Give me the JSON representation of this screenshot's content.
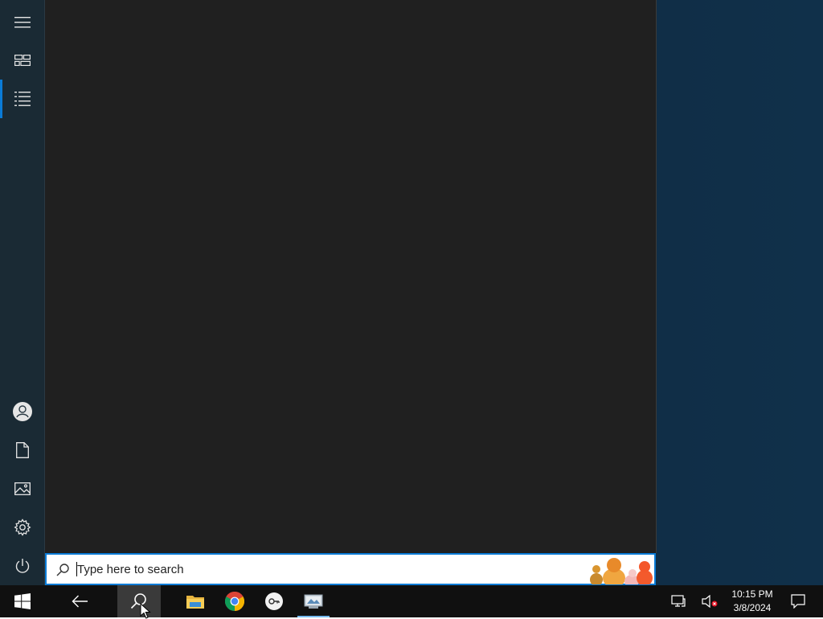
{
  "start_rail": {
    "top_items": [
      {
        "name": "expand-menu-button",
        "icon": "hamburger-icon"
      },
      {
        "name": "tiles-button",
        "icon": "tiles-icon"
      },
      {
        "name": "all-apps-button",
        "icon": "list-icon",
        "active": true
      }
    ],
    "bottom_items": [
      {
        "name": "user-account-button",
        "icon": "user-icon"
      },
      {
        "name": "documents-button",
        "icon": "document-icon"
      },
      {
        "name": "pictures-button",
        "icon": "picture-icon"
      },
      {
        "name": "settings-button",
        "icon": "gear-icon"
      },
      {
        "name": "power-button",
        "icon": "power-icon"
      }
    ]
  },
  "search": {
    "placeholder": "Type here to search",
    "value": ""
  },
  "taskbar": {
    "buttons": [
      {
        "name": "start-button",
        "icon": "windows-logo-icon"
      },
      {
        "name": "back-button",
        "icon": "back-arrow-icon"
      },
      {
        "name": "search-button",
        "icon": "search-icon",
        "pressed": true
      },
      {
        "name": "file-explorer-button",
        "icon": "folder-icon"
      },
      {
        "name": "chrome-button",
        "icon": "chrome-icon"
      },
      {
        "name": "app-button",
        "icon": "key-app-icon"
      },
      {
        "name": "control-panel-button",
        "icon": "control-panel-icon",
        "running": true
      }
    ],
    "tray": {
      "network_icon": "network-icon",
      "volume_icon": "volume-muted-icon",
      "time": "10:15 PM",
      "date": "3/8/2024",
      "notifications_icon": "action-center-icon"
    }
  },
  "colors": {
    "accent": "#0a7bd6",
    "panel": "#202020",
    "rail": "#1a2a34",
    "taskbar": "#101010"
  }
}
